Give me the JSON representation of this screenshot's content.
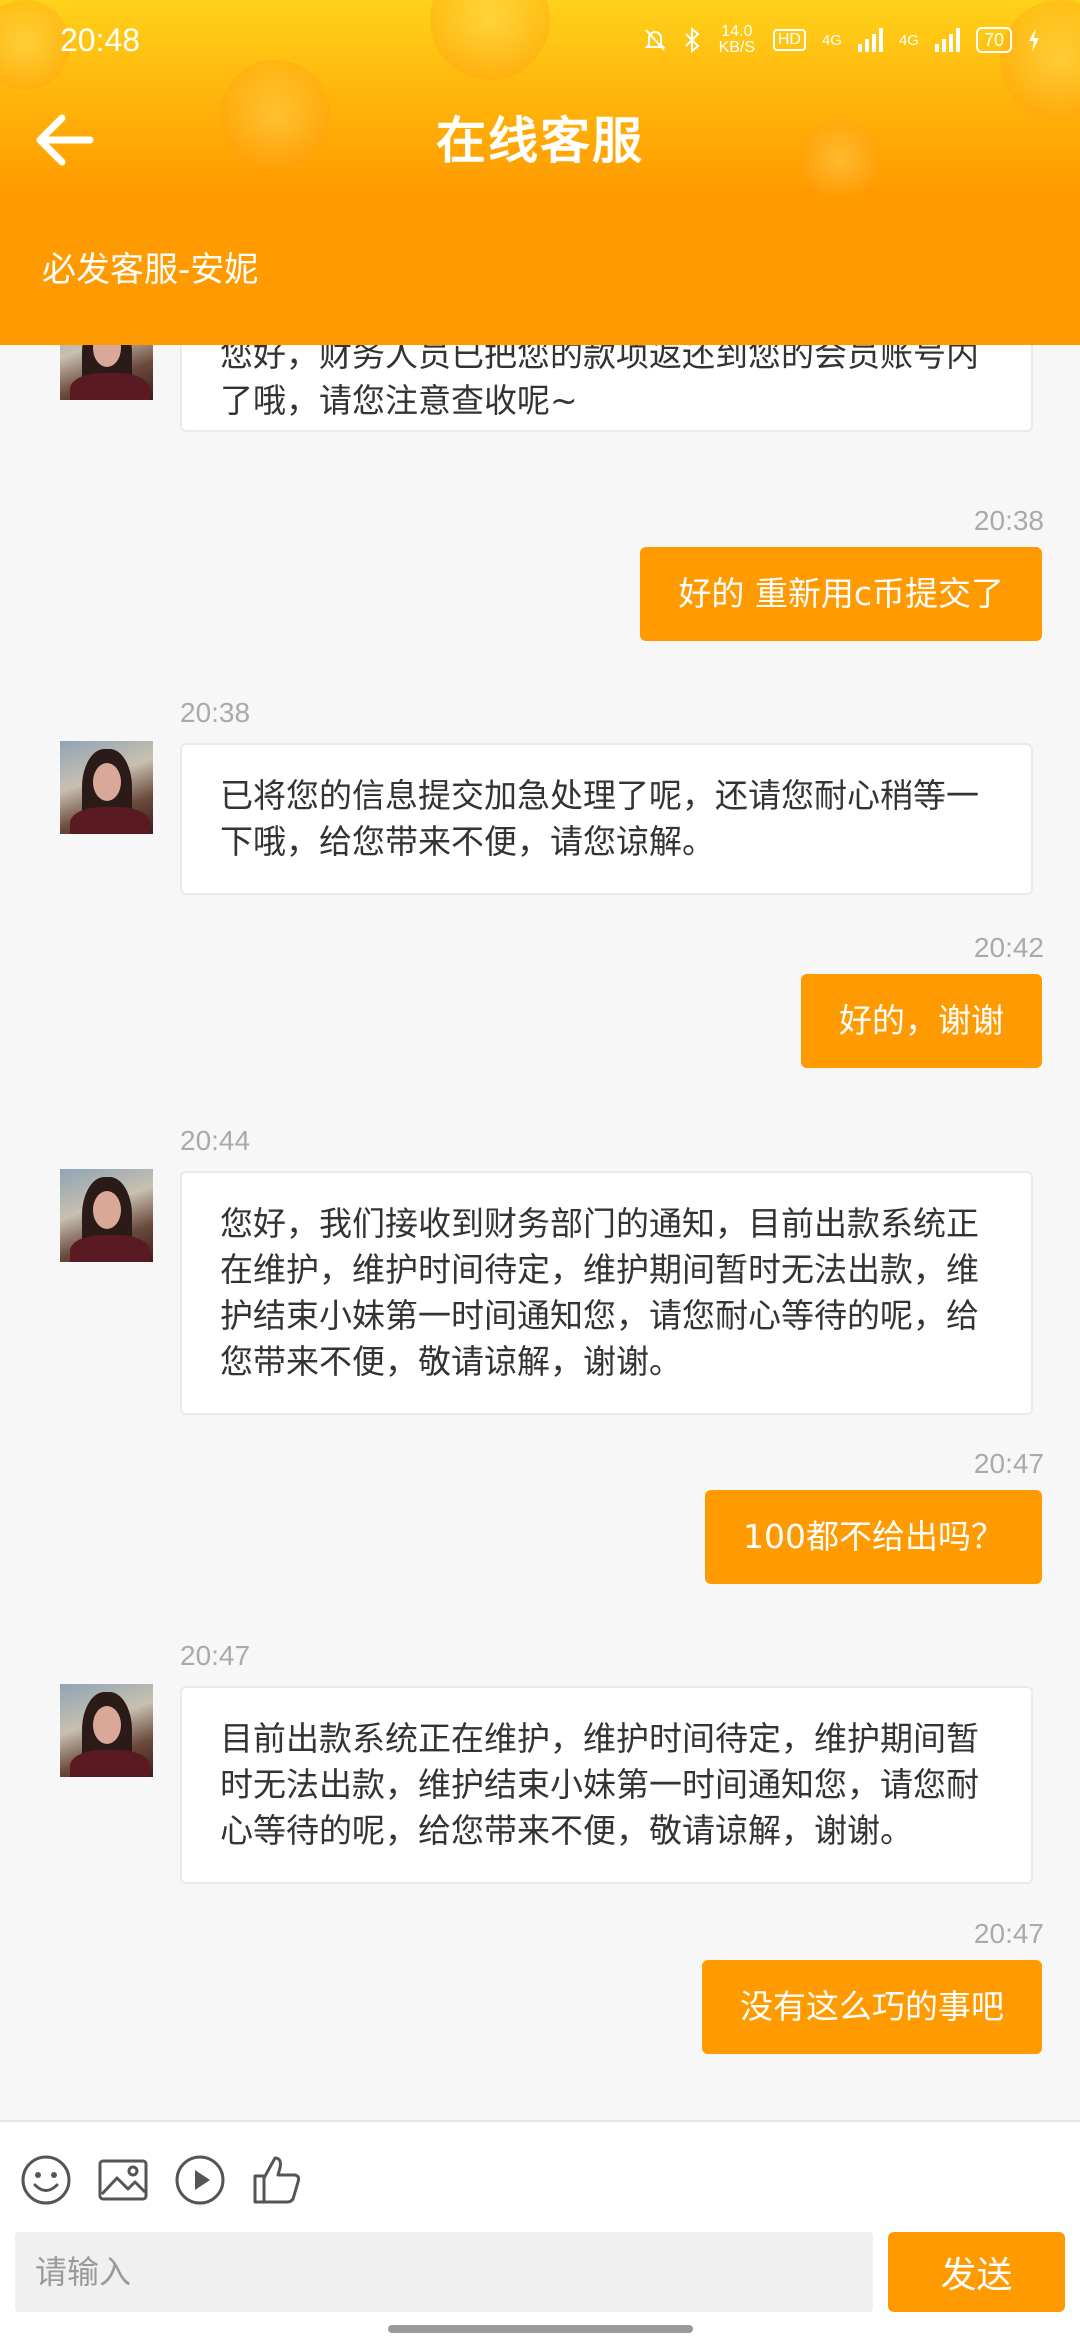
{
  "status_bar": {
    "time": "20:48",
    "net_speed": "14.0 KB/S",
    "hd": "HD",
    "sig1": "4G",
    "sig2": "4G",
    "battery": "70"
  },
  "header": {
    "title": "在线客服",
    "agent": "必发客服-安妮"
  },
  "messages": [
    {
      "side": "left",
      "time": "",
      "text": "您好，财务人员已把您的款项返还到您的会员账号内了哦，请您注意查收呢~"
    },
    {
      "side": "right",
      "time": "20:38",
      "text": "好的 重新用c币提交了"
    },
    {
      "side": "left",
      "time": "20:38",
      "text": "已将您的信息提交加急处理了呢，还请您耐心稍等一下哦，给您带来不便，请您谅解。"
    },
    {
      "side": "right",
      "time": "20:42",
      "text": "好的，谢谢"
    },
    {
      "side": "left",
      "time": "20:44",
      "text": "您好，我们接收到财务部门的通知，目前出款系统正在维护，维护时间待定，维护期间暂时无法出款，维护结束小妹第一时间通知您，请您耐心等待的呢，给您带来不便，敬请谅解，谢谢。"
    },
    {
      "side": "right",
      "time": "20:47",
      "text": "100都不给出吗？"
    },
    {
      "side": "left",
      "time": "20:47",
      "text": "目前出款系统正在维护，维护时间待定，维护期间暂时无法出款，维护结束小妹第一时间通知您，请您耐心等待的呢，给您带来不便，敬请谅解，谢谢。"
    },
    {
      "side": "right",
      "time": "20:47",
      "text": "没有这么巧的事吧"
    }
  ],
  "input": {
    "placeholder": "请输入"
  },
  "send_label": "发送",
  "tools": [
    "emoji-icon",
    "image-icon",
    "video-icon",
    "thumbs-up-icon"
  ],
  "colors": {
    "accent": "#ff9a00",
    "header_top": "#ffd21a"
  }
}
